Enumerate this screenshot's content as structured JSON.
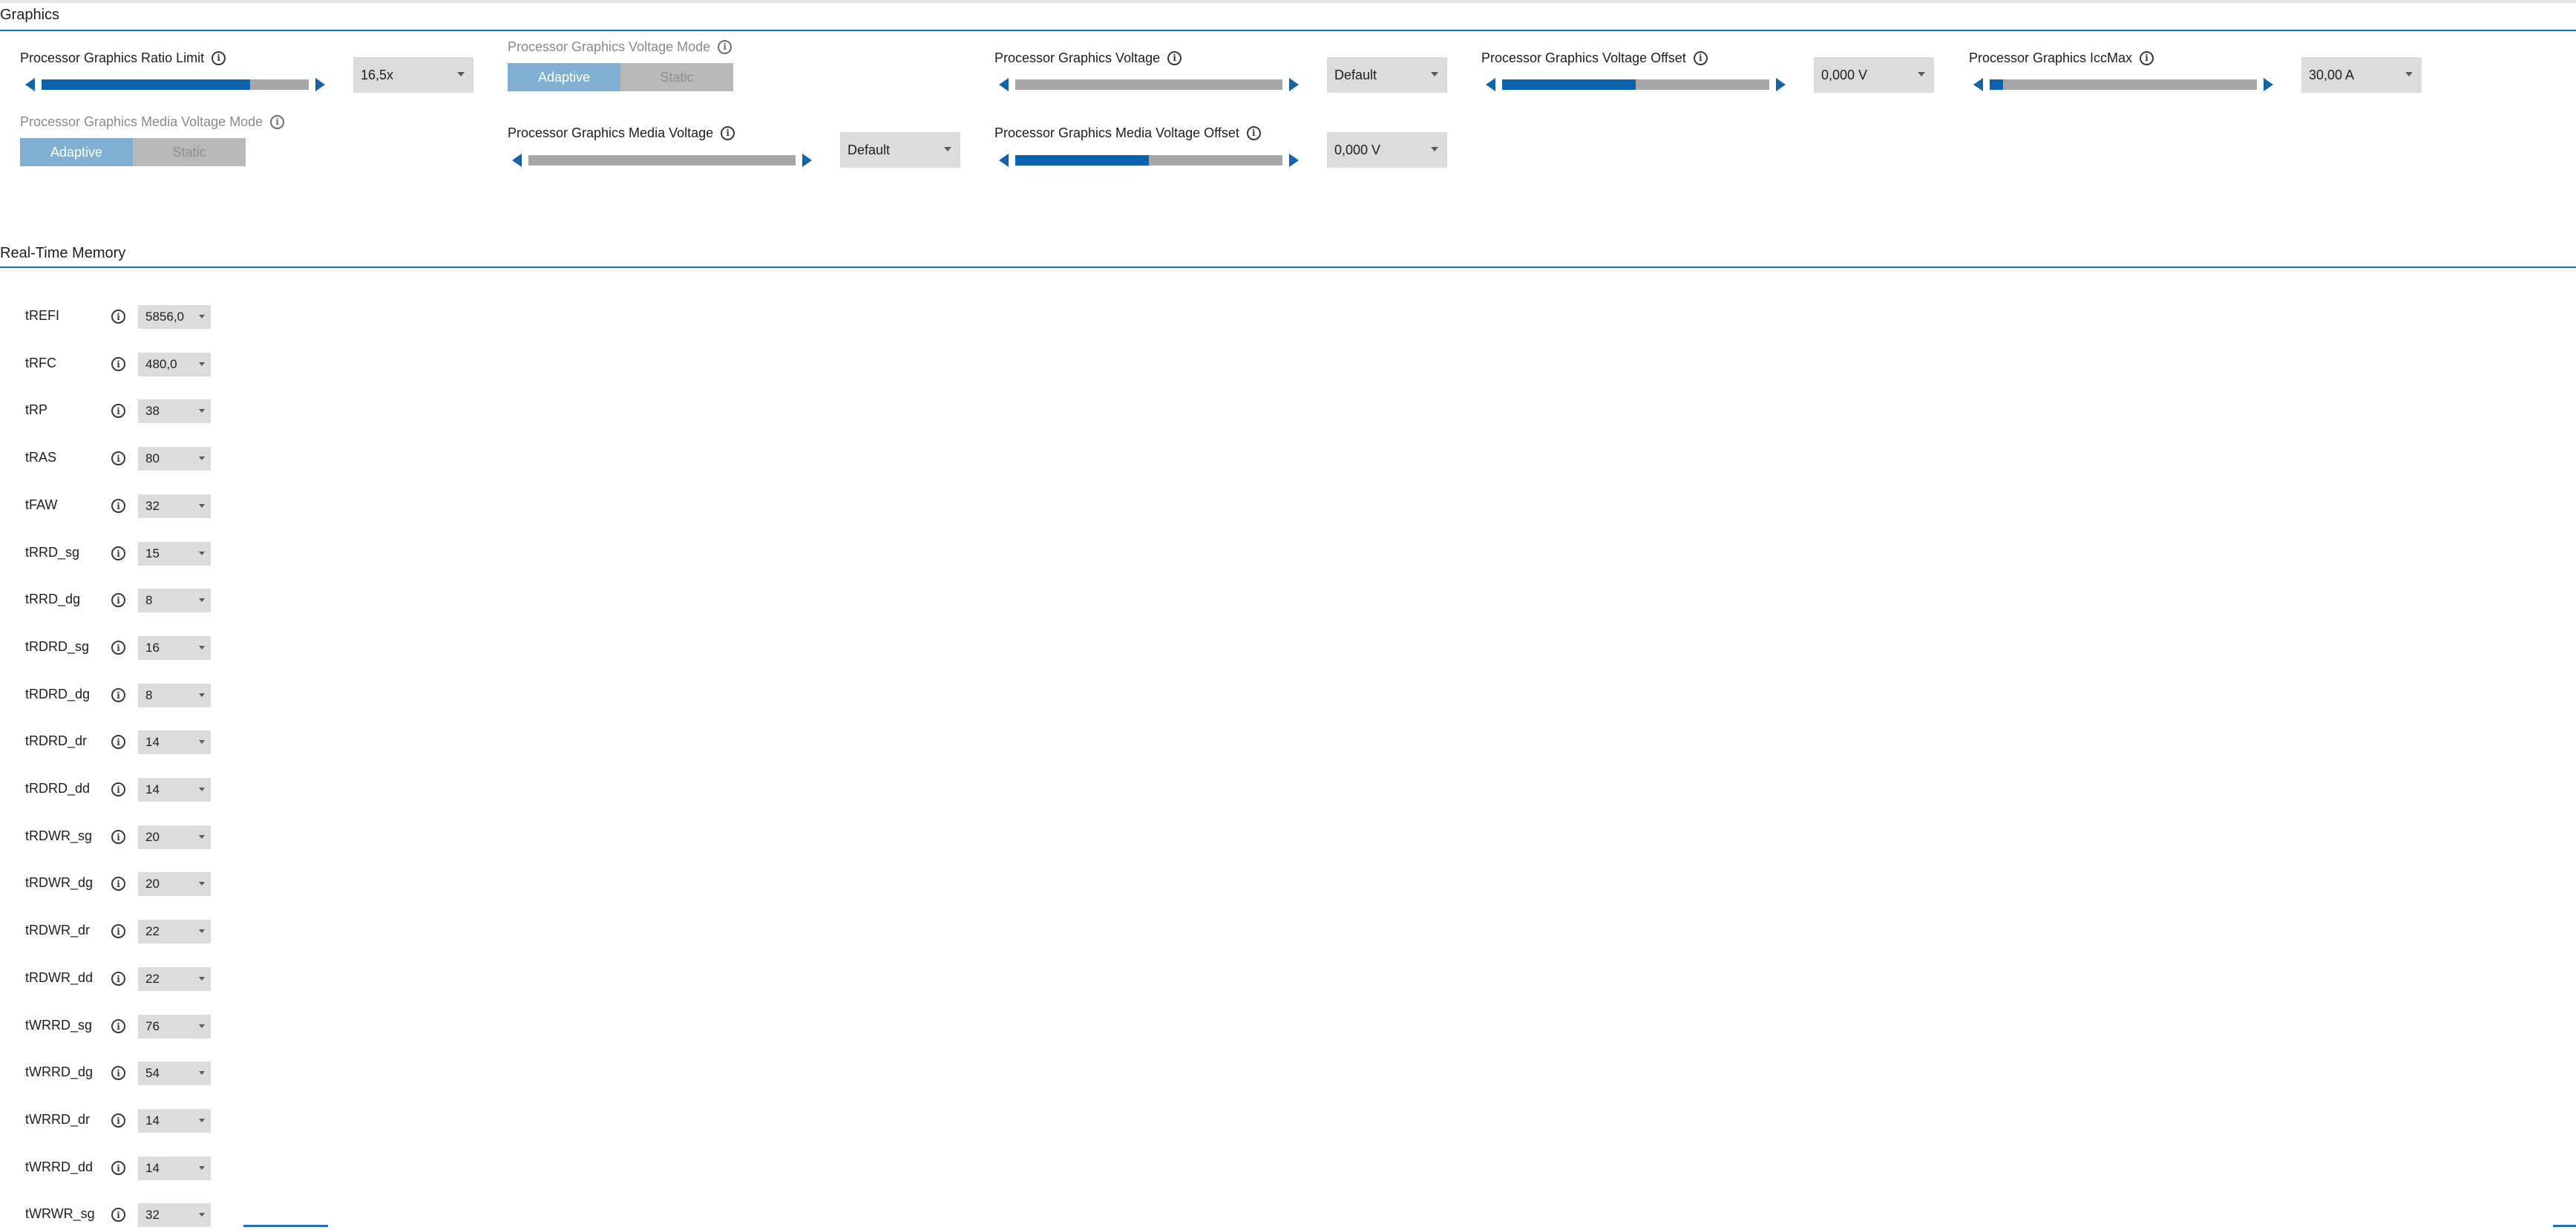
{
  "graphics": {
    "section_title": "Graphics",
    "ratio_limit": {
      "label": "Processor Graphics Ratio Limit",
      "value": "16,5x",
      "slider_fraction": 0.78
    },
    "voltage_mode": {
      "label": "Processor Graphics Voltage Mode",
      "options": [
        "Adaptive",
        "Static"
      ],
      "selected": "Adaptive"
    },
    "voltage": {
      "label": "Processor Graphics Voltage",
      "value": "Default",
      "slider_fraction": 0.0
    },
    "voltage_offset": {
      "label": "Processor Graphics Voltage Offset",
      "value": "0,000 V",
      "slider_fraction": 0.5
    },
    "iccmax": {
      "label": "Processor Graphics IccMax",
      "value": "30,00 A",
      "slider_fraction": 0.05
    },
    "media_voltage_mode": {
      "label": "Processor Graphics Media Voltage Mode",
      "options": [
        "Adaptive",
        "Static"
      ],
      "selected": "Adaptive"
    },
    "media_voltage": {
      "label": "Processor Graphics Media Voltage",
      "value": "Default",
      "slider_fraction": 0.0
    },
    "media_voltage_offset": {
      "label": "Processor Graphics Media Voltage Offset",
      "value": "0,000 V",
      "slider_fraction": 0.5
    }
  },
  "memory": {
    "section_title": "Real-Time Memory",
    "timings": [
      {
        "label": "tREFI",
        "value": "5856,0"
      },
      {
        "label": "tRFC",
        "value": "480,0"
      },
      {
        "label": "tRP",
        "value": "38"
      },
      {
        "label": "tRAS",
        "value": "80"
      },
      {
        "label": "tFAW",
        "value": "32"
      },
      {
        "label": "tRRD_sg",
        "value": "15"
      },
      {
        "label": "tRRD_dg",
        "value": "8"
      },
      {
        "label": "tRDRD_sg",
        "value": "16"
      },
      {
        "label": "tRDRD_dg",
        "value": "8"
      },
      {
        "label": "tRDRD_dr",
        "value": "14"
      },
      {
        "label": "tRDRD_dd",
        "value": "14"
      },
      {
        "label": "tRDWR_sg",
        "value": "20"
      },
      {
        "label": "tRDWR_dg",
        "value": "20"
      },
      {
        "label": "tRDWR_dr",
        "value": "22"
      },
      {
        "label": "tRDWR_dd",
        "value": "22"
      },
      {
        "label": "tWRRD_sg",
        "value": "76"
      },
      {
        "label": "tWRRD_dg",
        "value": "54"
      },
      {
        "label": "tWRRD_dr",
        "value": "14"
      },
      {
        "label": "tWRRD_dd",
        "value": "14"
      },
      {
        "label": "tWRWR_sg",
        "value": "32"
      }
    ]
  },
  "colors": {
    "accent": "#0b63b0",
    "track": "#a6a6a6",
    "toggle_on": "#7fb0d3",
    "toggle_off": "#b9b9b9",
    "dropdown_bg": "#dcdcdc"
  },
  "icons": {
    "info": "info-circle-icon",
    "slider_left": "triangle-left-icon",
    "slider_right": "triangle-right-icon",
    "dropdown": "chevron-down-icon"
  }
}
